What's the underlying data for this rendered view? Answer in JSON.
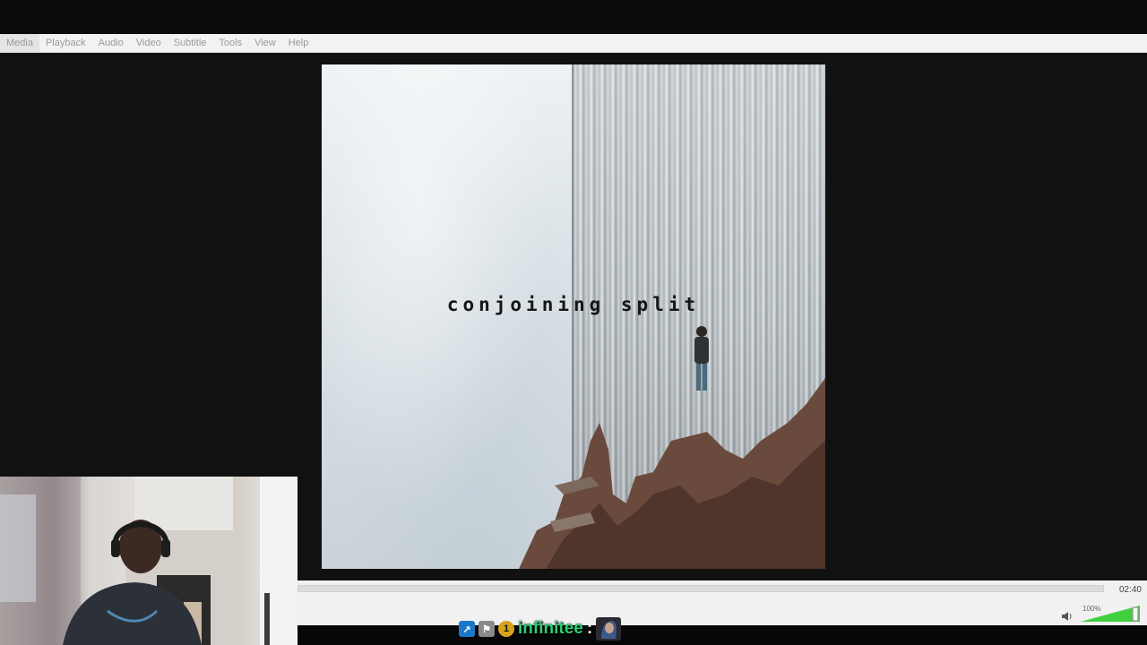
{
  "menu": {
    "items": [
      {
        "label": "Media"
      },
      {
        "label": "Playback"
      },
      {
        "label": "Audio"
      },
      {
        "label": "Video"
      },
      {
        "label": "Subtitle"
      },
      {
        "label": "Tools"
      },
      {
        "label": "View"
      },
      {
        "label": "Help"
      }
    ]
  },
  "cover": {
    "title": "conjoining split"
  },
  "player": {
    "time": "02:40",
    "volume_label": "100%",
    "volume_fraction": 1.0
  },
  "chat": {
    "username": "infinitee",
    "separator": ":",
    "name_color": "#2ecc71"
  },
  "icons": {
    "volume": "speaker-icon",
    "badges": [
      "arrow-badge-icon",
      "flag-badge-icon",
      "gold-badge-icon"
    ],
    "emote": "emote-icon"
  }
}
